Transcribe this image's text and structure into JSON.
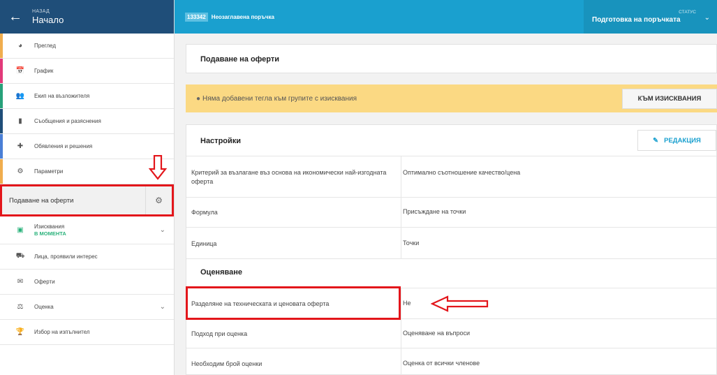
{
  "sidebar": {
    "back_small": "НАЗАД",
    "back_title": "Начало",
    "items": [
      {
        "label": "Преглед",
        "stripe": "#f0ad4e"
      },
      {
        "label": "График",
        "stripe": "#e23a7a"
      },
      {
        "label": "Екип на възложителя",
        "stripe": "#27a17a"
      },
      {
        "label": "Съобщения и разяснения",
        "stripe": "#1f4e79"
      },
      {
        "label": "Обявления и решения",
        "stripe": "#4a7fd6"
      },
      {
        "label": "Параметри",
        "stripe": "#f0ad4e"
      }
    ],
    "submission_label": "Подаване на оферти",
    "requirements_label": "Изисквания",
    "requirements_sub": "В МОМЕНТА",
    "interested_label": "Лица, проявили интерес",
    "offers_label": "Оферти",
    "evaluation_label": "Оценка",
    "contractor_label": "Избор на изпълнител"
  },
  "topbar": {
    "proc_id": "133342",
    "proc_title": "Неозаглавена поръчка",
    "status_small": "СТАТУС",
    "status_value": "Подготовка на поръчката"
  },
  "main": {
    "section_title": "Подаване на оферти",
    "warning_text": "Няма добавени тегла към групите с изисквания",
    "to_requirements_button": "КЪМ ИЗИСКВАНИЯ",
    "settings_title": "Настройки",
    "edit_button": "РЕДАКЦИЯ",
    "settings_rows": [
      {
        "key": "Критерий за възлагане въз основа на икономически най-изгодната оферта",
        "value": "Оптимално съотношение качество/цена"
      },
      {
        "key": "Формула",
        "value": "Присъждане на точки"
      },
      {
        "key": "Единица",
        "value": "Точки"
      }
    ],
    "evaluation_title": "Оценяване",
    "evaluation_rows": [
      {
        "key": "Разделяне на техническата и ценовата оферта",
        "value": "Не"
      },
      {
        "key": "Подход при оценка",
        "value": "Оценяване на въпроси"
      },
      {
        "key": "Необходим брой оценки",
        "value": "Оценка от всички членове"
      }
    ]
  }
}
